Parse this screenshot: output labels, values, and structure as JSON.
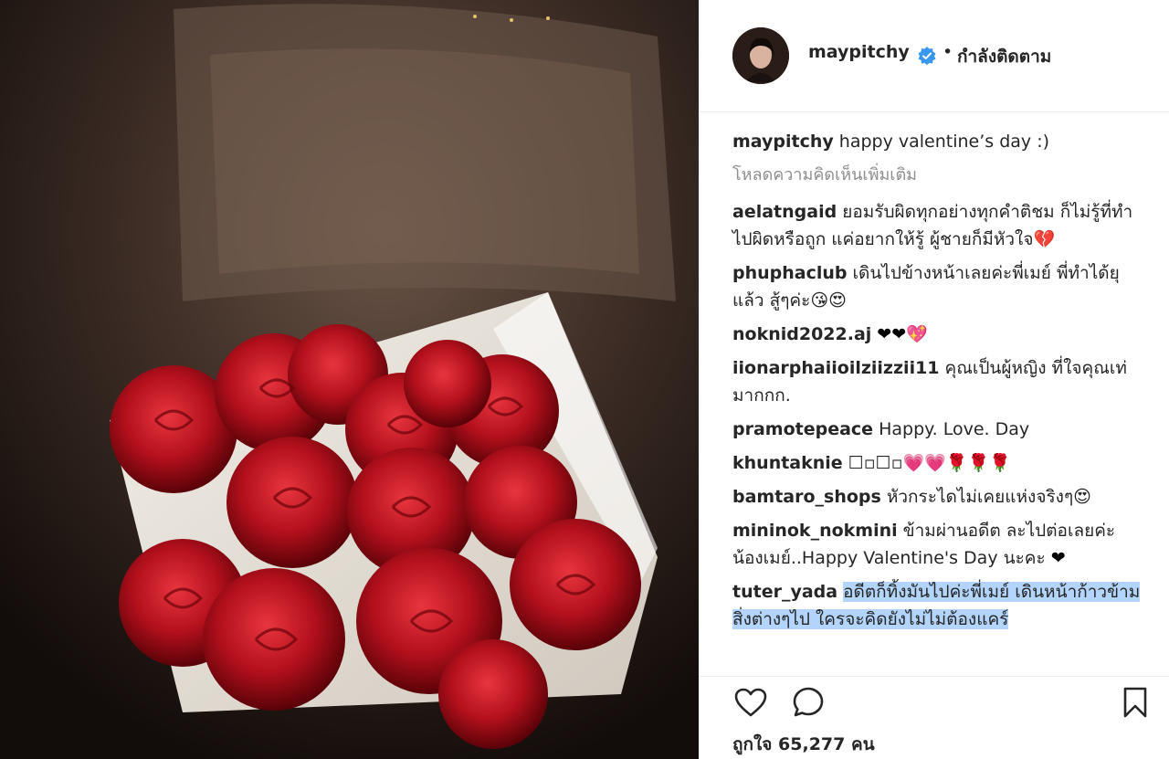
{
  "post": {
    "username": "maypitchy",
    "follow_status": "กำลังติดตาม",
    "dot": "•"
  },
  "caption": {
    "username": "maypitchy",
    "text": "happy valentine’s day :)"
  },
  "load_more": "โหลดความคิดเห็นเพิ่มเติม",
  "comments": [
    {
      "username": "aelatngaid",
      "text": "ยอมรับผิดทุกอย่างทุกคำติชม ก็ไม่รู้ที่ทำไปผิดหรือถูก แค่อยากให้รู้ ผู้ชายก็มีหัวใจ",
      "emoji": "💔"
    },
    {
      "username": "phuphaclub",
      "text": "เดินไปข้างหน้าเลยค่ะพี่เมย์ พี่ทำได้ยุแล้ว สู้ๆค่ะ",
      "emoji": "😘😍"
    },
    {
      "username": "noknid2022.aj",
      "text": "",
      "emoji": "❤❤💖"
    },
    {
      "username": "iionarphaiioilziizzii11",
      "text": "คุณเป็นผู้หญิง ที่ใจคุณเท่มากกก.",
      "emoji": ""
    },
    {
      "username": "pramotepeace",
      "text": "Happy. Love. Day",
      "emoji": ""
    },
    {
      "username": "khuntaknie",
      "text": "☐▫☐▫",
      "emoji": "💗💗🌹🌹🌹"
    },
    {
      "username": "bamtaro_shops",
      "text": "หัวกระไดไม่เคยแห่งจริงๆ",
      "emoji": "😍"
    },
    {
      "username": "mininok_nokmini",
      "text": "ข้ามผ่านอดีต ละไปต่อเลยค่ะน้องเมย์..Happy Valentine's Day นะคะ",
      "emoji": "❤"
    },
    {
      "username": "tuter_yada",
      "text": "อดีตก็ทิ้งมันไปค่ะพี่เมย์ เดินหน้าก้าวข้ามสิ่งต่างๆไป ใครจะคิดยังไม่ไม่ต้องแคร์",
      "emoji": ""
    }
  ],
  "likes": "ถูกใจ 65,277 คน",
  "icons": {
    "like": "heart-icon",
    "comment": "comment-icon",
    "save": "bookmark-icon",
    "verified": "verified-badge-icon"
  },
  "colors": {
    "verified": "#3897f0",
    "muted": "#8e8e8e",
    "text": "#262626",
    "selection": "#b3d4fc"
  }
}
